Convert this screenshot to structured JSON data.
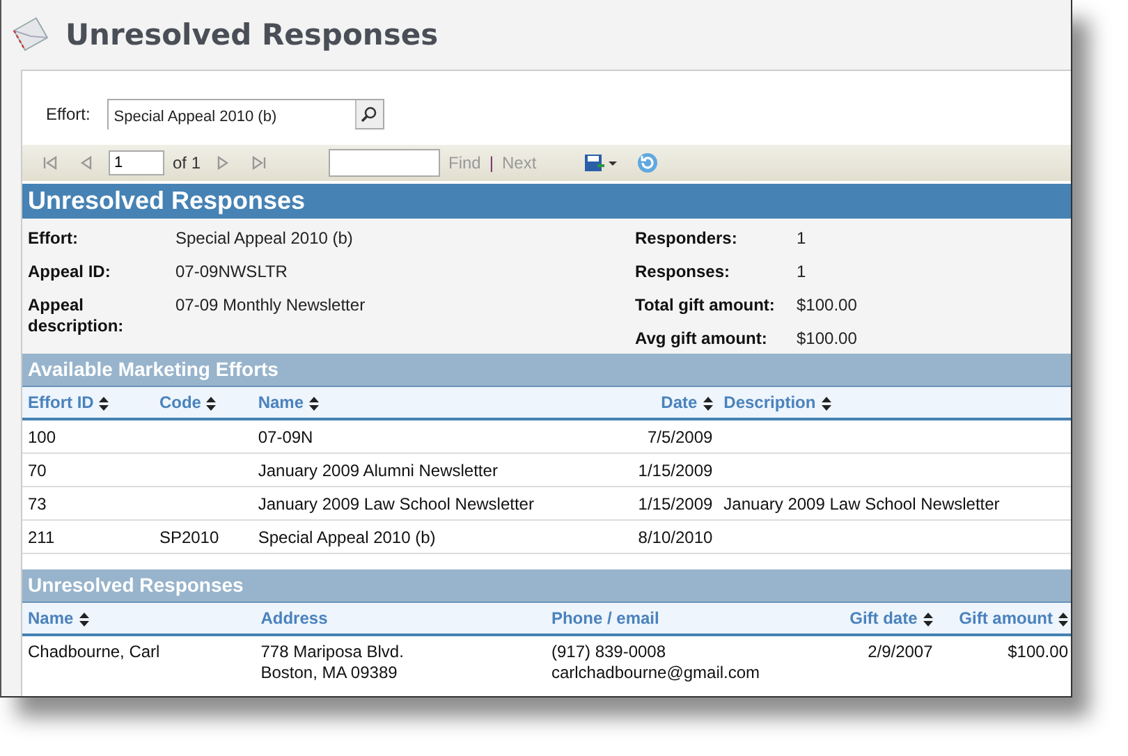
{
  "page_title": "Unresolved Responses",
  "effort_field": {
    "label": "Effort:",
    "value": "Special Appeal 2010 (b)"
  },
  "toolbar": {
    "page": "1",
    "of": "of 1",
    "find": "Find",
    "separator": "|",
    "next": "Next"
  },
  "report": {
    "title": "Unresolved Responses",
    "summary_left": [
      {
        "label": "Effort:",
        "value": "Special Appeal 2010 (b)"
      },
      {
        "label": "Appeal ID:",
        "value": "07-09NWSLTR"
      },
      {
        "label": "Appeal description:",
        "value": "07-09 Monthly Newsletter"
      }
    ],
    "summary_right": [
      {
        "label": "Responders:",
        "value": "1"
      },
      {
        "label": "Responses:",
        "value": "1"
      },
      {
        "label": "Total gift amount:",
        "value": "$100.00"
      },
      {
        "label": "Avg gift amount:",
        "value": "$100.00"
      }
    ],
    "efforts": {
      "title": "Available Marketing Efforts",
      "columns": [
        {
          "label": "Effort ID",
          "sortable": true,
          "kind": "text"
        },
        {
          "label": "Code",
          "sortable": true,
          "kind": "text"
        },
        {
          "label": "Name",
          "sortable": true,
          "kind": "text"
        },
        {
          "label": "Date",
          "sortable": true,
          "kind": "number"
        },
        {
          "label": "Description",
          "sortable": true,
          "kind": "text"
        }
      ],
      "rows": [
        [
          "100",
          "",
          "07-09N",
          "7/5/2009",
          ""
        ],
        [
          "70",
          "",
          "January 2009 Alumni Newsletter",
          "1/15/2009",
          ""
        ],
        [
          "73",
          "",
          "January 2009 Law School Newsletter",
          "1/15/2009",
          "January 2009 Law School Newsletter"
        ],
        [
          "211",
          "SP2010",
          "Special Appeal 2010 (b)",
          "8/10/2010",
          ""
        ]
      ]
    },
    "responses": {
      "title": "Unresolved Responses",
      "columns": [
        {
          "label": "Name",
          "sortable": true,
          "kind": "text"
        },
        {
          "label": "Address",
          "sortable": false,
          "kind": "text"
        },
        {
          "label": "Phone / email",
          "sortable": false,
          "kind": "text"
        },
        {
          "label": "Gift date",
          "sortable": true,
          "kind": "number"
        },
        {
          "label": "Gift amount",
          "sortable": true,
          "kind": "number"
        }
      ],
      "rows": [
        [
          [
            "Chadbourne, Carl"
          ],
          [
            "778 Mariposa Blvd.",
            "Boston, MA  09389"
          ],
          [
            "(917) 839-0008",
            "carlchadbourne@gmail.com"
          ],
          [
            "2/9/2007"
          ],
          [
            "$100.00"
          ]
        ]
      ]
    }
  }
}
